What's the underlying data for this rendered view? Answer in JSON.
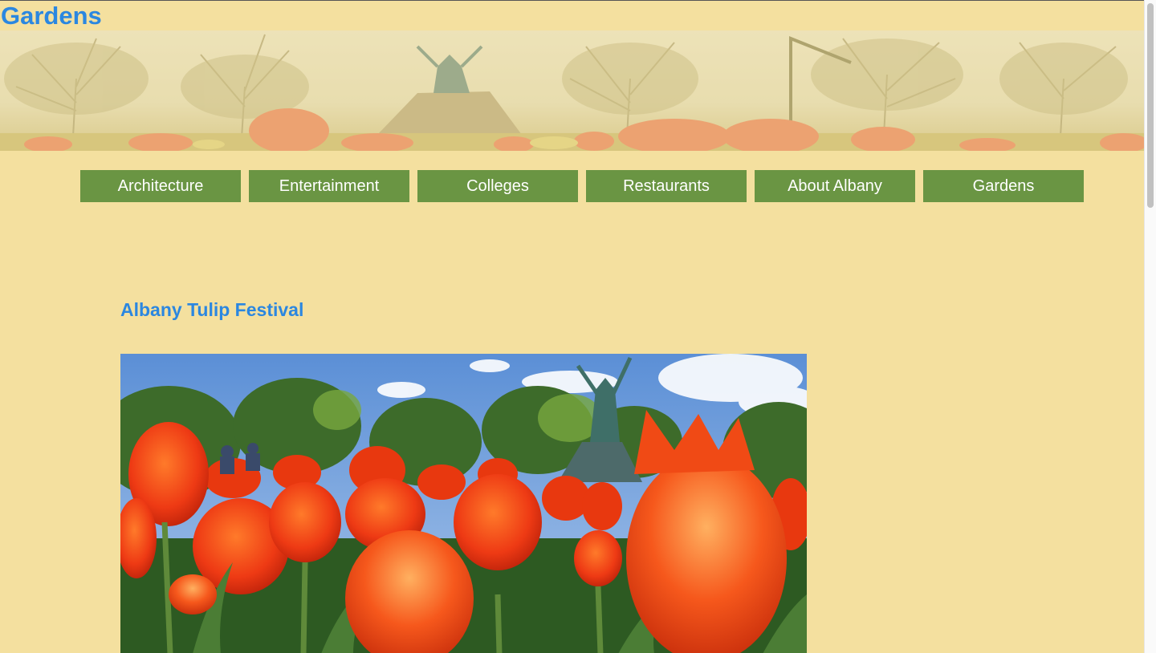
{
  "site": {
    "title": "Gardens"
  },
  "nav": {
    "items": [
      {
        "label": "Architecture"
      },
      {
        "label": "Entertainment"
      },
      {
        "label": "Colleges"
      },
      {
        "label": "Restaurants"
      },
      {
        "label": "About Albany"
      },
      {
        "label": "Gardens"
      }
    ]
  },
  "main": {
    "heading": "Albany Tulip Festival"
  },
  "colors": {
    "background": "#f4e09f",
    "accent_text": "#2b87e0",
    "nav_button": "#6a9543",
    "nav_text": "#ffffff"
  },
  "images": {
    "banner": "faded-tulip-park-banner",
    "photo": "red-tulips-with-statue-photo"
  }
}
